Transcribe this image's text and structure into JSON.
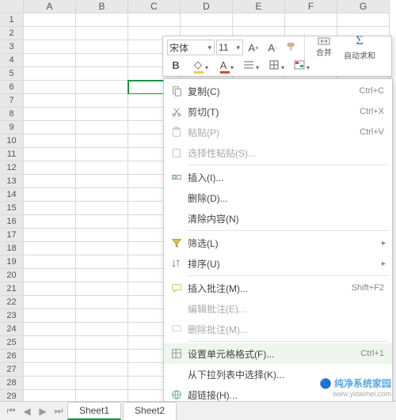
{
  "columns": [
    "A",
    "B",
    "C",
    "D",
    "E",
    "F",
    "G"
  ],
  "row_start": 1,
  "row_end": 29,
  "selected_cell": {
    "row": 6,
    "col": "C"
  },
  "mini_toolbar": {
    "font_name": "宋体",
    "font_size": "11",
    "merge_label": "合并",
    "autosum_label": "自动求和"
  },
  "context_menu": [
    {
      "icon": "copy",
      "label": "复制(C)",
      "shortcut": "Ctrl+C",
      "enabled": true
    },
    {
      "icon": "cut",
      "label": "剪切(T)",
      "shortcut": "Ctrl+X",
      "enabled": true
    },
    {
      "icon": "paste",
      "label": "粘贴(P)",
      "shortcut": "Ctrl+V",
      "enabled": false
    },
    {
      "icon": "paste-special",
      "label": "选择性粘贴(S)...",
      "enabled": false
    },
    {
      "sep": true
    },
    {
      "icon": "insert",
      "label": "插入(I)...",
      "enabled": true
    },
    {
      "label": "删除(D)...",
      "enabled": true
    },
    {
      "label": "清除内容(N)",
      "enabled": true
    },
    {
      "sep": true
    },
    {
      "icon": "filter",
      "label": "筛选(L)",
      "enabled": true,
      "submenu": true
    },
    {
      "icon": "sort",
      "label": "排序(U)",
      "enabled": true,
      "submenu": true
    },
    {
      "sep": true
    },
    {
      "icon": "comment",
      "label": "插入批注(M)...",
      "shortcut": "Shift+F2",
      "enabled": true
    },
    {
      "label": "编辑批注(E)...",
      "enabled": false
    },
    {
      "icon": "del-comment",
      "label": "删除批注(M)...",
      "enabled": false
    },
    {
      "sep": true
    },
    {
      "icon": "format",
      "label": "设置单元格格式(F)...",
      "shortcut": "Ctrl+1",
      "enabled": true,
      "highlighted": true
    },
    {
      "label": "从下拉列表中选择(K)...",
      "enabled": true
    },
    {
      "icon": "link",
      "label": "超链接(H)...",
      "enabled": true
    }
  ],
  "tabs": [
    "Sheet1",
    "Sheet2"
  ],
  "active_tab": 0,
  "watermark": {
    "title": "纯净系统家园",
    "url": "www.yidaimei.com"
  }
}
